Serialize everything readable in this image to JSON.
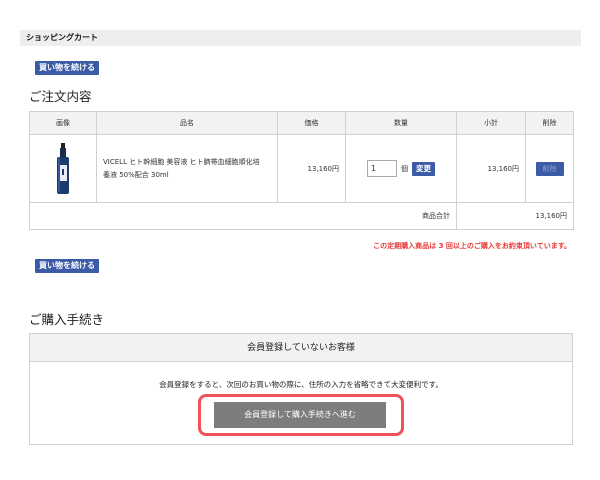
{
  "page_title": "ショッピングカート",
  "continue_button_label": "買い物を続ける",
  "order_section_title": "ご注文内容",
  "table_headers": {
    "image": "画像",
    "name": "品名",
    "price": "価格",
    "quantity": "数量",
    "subtotal": "小計",
    "delete": "削除"
  },
  "item": {
    "name_line1": "VICELL ヒト幹細胞 美容液 ヒト臍帯血細胞順化培",
    "name_line2": "養液 50%配合 30ml",
    "price": "13,160円",
    "quantity": "1",
    "unit": "個",
    "change_label": "変更",
    "subtotal": "13,160円",
    "delete_label": "削除"
  },
  "total": {
    "label": "商品合計",
    "value": "13,160円"
  },
  "notice": "この定期購入商品は 3 回以上のご購入をお約束頂いています。",
  "checkout_section_title": "ご購入手続き",
  "guest": {
    "header": "会員登録していないお客様",
    "description": "会員登録をすると、次回のお買い物の際に、住所の入力を省略できて大変便利です。",
    "register_button": "会員登録して購入手続きへ進む"
  },
  "colors": {
    "button_blue": "#3c5ba7",
    "notice_red": "#e53935",
    "highlight_border": "#f0525a",
    "register_button": "#7d7d7d"
  }
}
